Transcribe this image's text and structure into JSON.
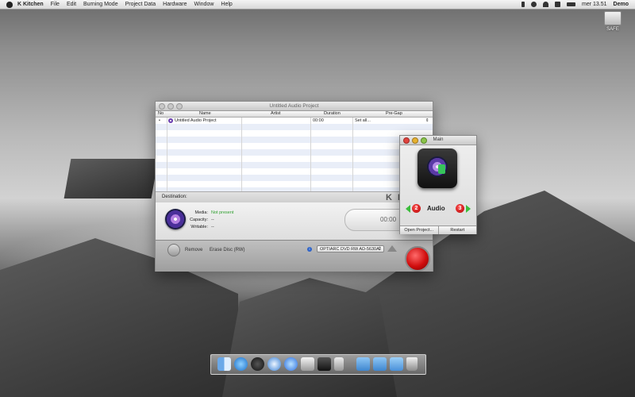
{
  "menubar": {
    "app_name": "K Kitchen",
    "items": [
      "File",
      "Edit",
      "Burning Mode",
      "Project Data",
      "Hardware",
      "Window",
      "Help"
    ],
    "clock": "mer 13.51",
    "user": "Demo"
  },
  "desktop": {
    "drive_label": "SAFE"
  },
  "project_window": {
    "title": "Untitled Audio Project",
    "columns": [
      "No",
      "Name",
      "Artist",
      "Duration",
      "Pre-Gap"
    ],
    "rows": [
      {
        "no": "•",
        "name": "Untitled Audio Project",
        "artist": "",
        "duration": "00:00",
        "pregap": "Set all..."
      }
    ],
    "destination_label": "Destination:",
    "brand_text": "K Kit",
    "media_key": "Media:",
    "media_value": "Not present",
    "capacity_key": "Capacity:",
    "capacity_value": "--",
    "writable_key": "Writable:",
    "writable_value": "--",
    "timer": "00:00",
    "remove_label": "Remove",
    "erase_label": "Erase Disc (RW)",
    "drive_select": "OPTIARC DVD RW AD-5630A",
    "info_glyph": "i"
  },
  "main_window": {
    "title": "Main",
    "mode_label": "Audio",
    "prev_number": "2",
    "next_number": "3",
    "open_button": "Open Project...",
    "restart_button": "Restart"
  },
  "colors": {
    "not_present": "#2fa02f",
    "burn_red": "#d10e0e",
    "arrow_green": "#3cbd3c"
  }
}
